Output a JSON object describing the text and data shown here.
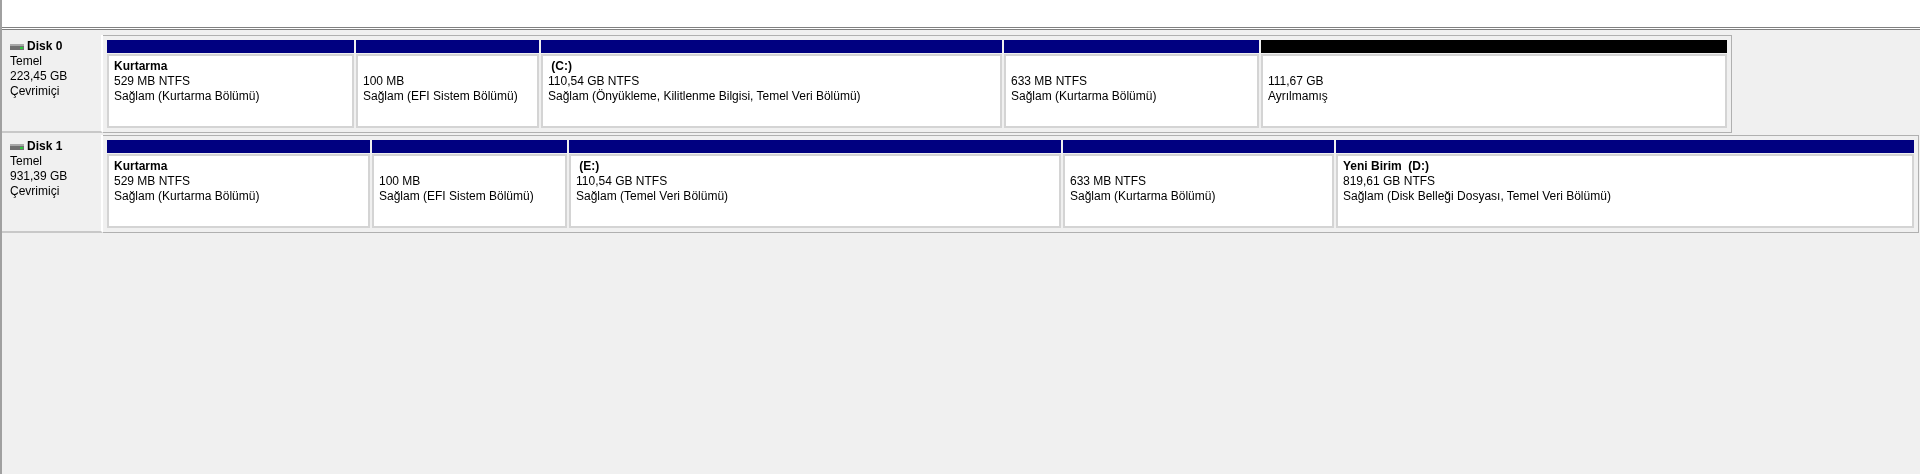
{
  "disks": [
    {
      "name": "Disk 0",
      "type": "Temel",
      "size": "223,45 GB",
      "status": "Çevrimiçi",
      "partitions": [
        {
          "kind": "primary",
          "name": "Kurtarma",
          "size": "529 MB NTFS",
          "status": "Sağlam (Kurtarma Bölümü)"
        },
        {
          "kind": "primary",
          "size": "100 MB",
          "status": "Sağlam (EFI Sistem Bölümü)"
        },
        {
          "kind": "primary",
          "name": " (C:)",
          "size": "110,54 GB NTFS",
          "status": "Sağlam (Önyükleme, Kilitlenme Bilgisi, Temel Veri Bölümü)"
        },
        {
          "kind": "primary",
          "size": "633 MB NTFS",
          "status": "Sağlam (Kurtarma Bölümü)"
        },
        {
          "kind": "unallocated",
          "size": "111,67 GB",
          "status": "Ayrılmamış"
        }
      ]
    },
    {
      "name": "Disk 1",
      "type": "Temel",
      "size": "931,39 GB",
      "status": "Çevrimiçi",
      "partitions": [
        {
          "kind": "primary",
          "name": "Kurtarma",
          "size": "529 MB NTFS",
          "status": "Sağlam (Kurtarma Bölümü)"
        },
        {
          "kind": "primary",
          "size": "100 MB",
          "status": "Sağlam (EFI Sistem Bölümü)"
        },
        {
          "kind": "primary",
          "name": " (E:)",
          "size": "110,54 GB NTFS",
          "status": "Sağlam (Temel Veri Bölümü)"
        },
        {
          "kind": "primary",
          "size": "633 MB NTFS",
          "status": "Sağlam (Kurtarma Bölümü)"
        },
        {
          "kind": "primary",
          "name": "Yeni Birim  (D:)",
          "size": "819,61 GB NTFS",
          "status": "Sağlam (Disk Belleği Dosyası, Temel Veri Bölümü)"
        }
      ]
    }
  ]
}
